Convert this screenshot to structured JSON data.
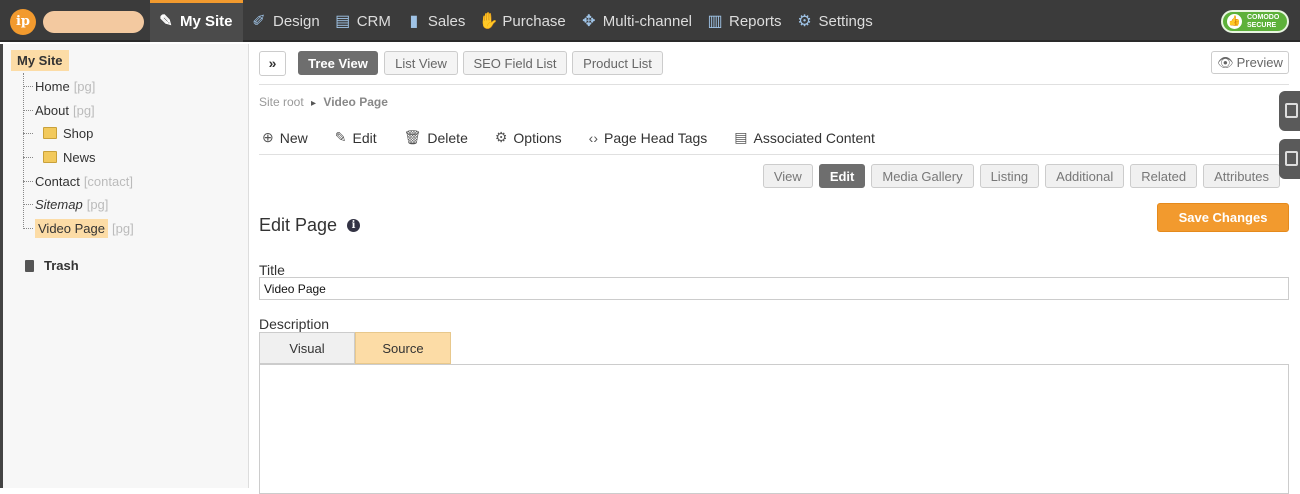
{
  "topnav": {
    "items": [
      {
        "label": "My Site",
        "icon": "page-edit-icon"
      },
      {
        "label": "Design",
        "icon": "brush-icon"
      },
      {
        "label": "CRM",
        "icon": "contact-card-icon"
      },
      {
        "label": "Sales",
        "icon": "bar-chart-tag-icon"
      },
      {
        "label": "Purchase",
        "icon": "handshake-icon"
      },
      {
        "label": "Multi-channel",
        "icon": "network-icon"
      },
      {
        "label": "Reports",
        "icon": "report-icon"
      },
      {
        "label": "Settings",
        "icon": "gear-icon"
      }
    ],
    "badge": {
      "line1": "COMODO",
      "line2": "SECURE"
    }
  },
  "sidebar": {
    "root": "My Site",
    "items": [
      {
        "label": "Home",
        "tag": "[pg]"
      },
      {
        "label": "About",
        "tag": "[pg]"
      },
      {
        "label": "Shop",
        "tag": ""
      },
      {
        "label": "News",
        "tag": ""
      },
      {
        "label": "Contact",
        "tag": "[contact]"
      },
      {
        "label": "Sitemap",
        "tag": "[pg]"
      },
      {
        "label": "Video Page",
        "tag": "[pg]"
      }
    ],
    "trash": "Trash"
  },
  "toolbar": {
    "expand": "»",
    "views": [
      "Tree View",
      "List View",
      "SEO Field List",
      "Product List"
    ],
    "preview": "Preview"
  },
  "breadcrumb": {
    "root": "Site root",
    "separator": "▸",
    "current": "Video Page"
  },
  "actions": [
    {
      "label": "New",
      "icon": "plus-circle-icon"
    },
    {
      "label": "Edit",
      "icon": "pencil-icon"
    },
    {
      "label": "Delete",
      "icon": "trash-icon"
    },
    {
      "label": "Options",
      "icon": "gear-icon"
    },
    {
      "label": "Page Head Tags",
      "icon": "code-icon"
    },
    {
      "label": "Associated Content",
      "icon": "list-icon"
    }
  ],
  "subtabs": [
    "View",
    "Edit",
    "Media Gallery",
    "Listing",
    "Additional",
    "Related",
    "Attributes"
  ],
  "page": {
    "title": "Edit Page",
    "info": "i",
    "save": "Save Changes",
    "title_label": "Title",
    "title_value": "Video Page",
    "description_label": "Description",
    "editor_tabs": [
      "Visual",
      "Source"
    ]
  },
  "colors": {
    "accent": "#f29a2e",
    "topbar": "#3b3b3b",
    "highlight": "#fcdca6"
  }
}
